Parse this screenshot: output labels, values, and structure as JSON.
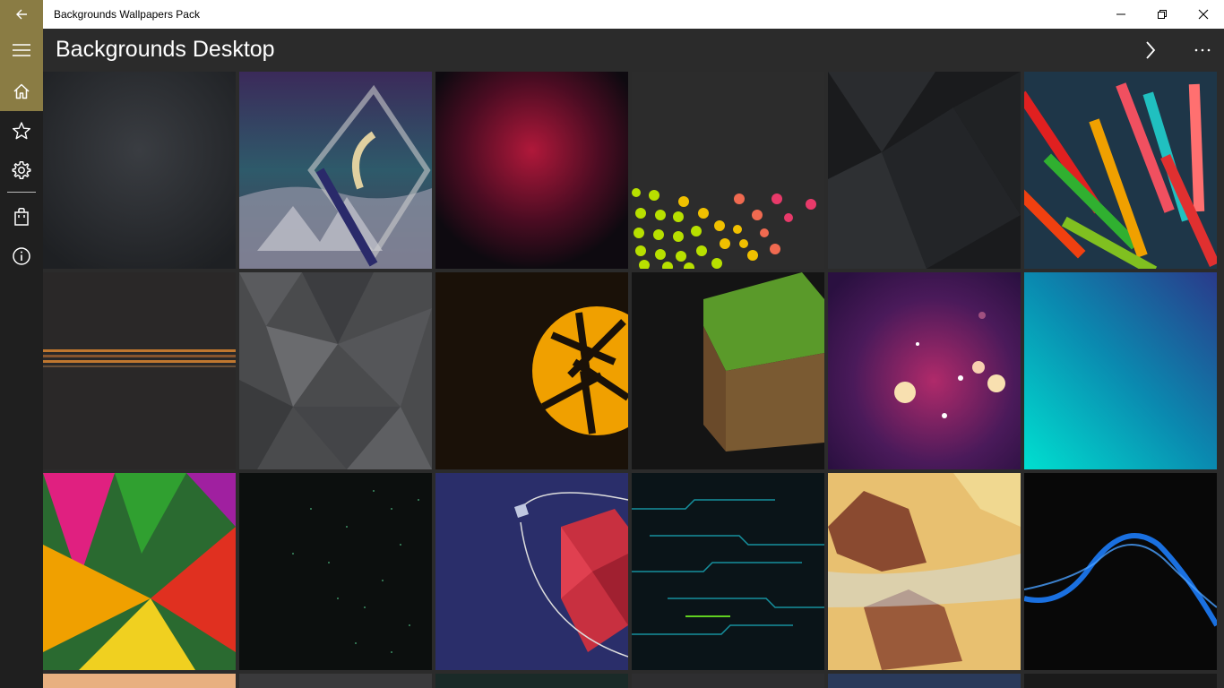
{
  "window": {
    "title": "Backgrounds Wallpapers Pack"
  },
  "header": {
    "page_title": "Backgrounds Desktop"
  },
  "icons": {
    "back": "back-arrow-icon",
    "menu": "hamburger-icon",
    "home": "home-icon",
    "favorites": "star-icon",
    "settings": "gear-icon",
    "store": "shopping-bag-icon",
    "about": "info-icon",
    "next": "chevron-right-icon",
    "more": "more-dots-icon"
  },
  "colors": {
    "accent": "#8a7c44",
    "sidebar": "#1f1f1f",
    "background": "#2b2b2b"
  },
  "wallpapers": [
    {
      "name": "dark-texture"
    },
    {
      "name": "mountain-planet-triangle"
    },
    {
      "name": "crimson-gradient"
    },
    {
      "name": "colored-dots"
    },
    {
      "name": "black-geometric"
    },
    {
      "name": "3d-colorful-bars"
    },
    {
      "name": "dotted-stripe"
    },
    {
      "name": "gray-polygons"
    },
    {
      "name": "orange-aperture"
    },
    {
      "name": "grass-block-cube"
    },
    {
      "name": "purple-bokeh"
    },
    {
      "name": "teal-blue-gradient"
    },
    {
      "name": "rainbow-abstract"
    },
    {
      "name": "green-particles"
    },
    {
      "name": "red-low-poly-planet"
    },
    {
      "name": "circuit-lines"
    },
    {
      "name": "low-poly-landscape"
    },
    {
      "name": "blue-wave"
    }
  ]
}
